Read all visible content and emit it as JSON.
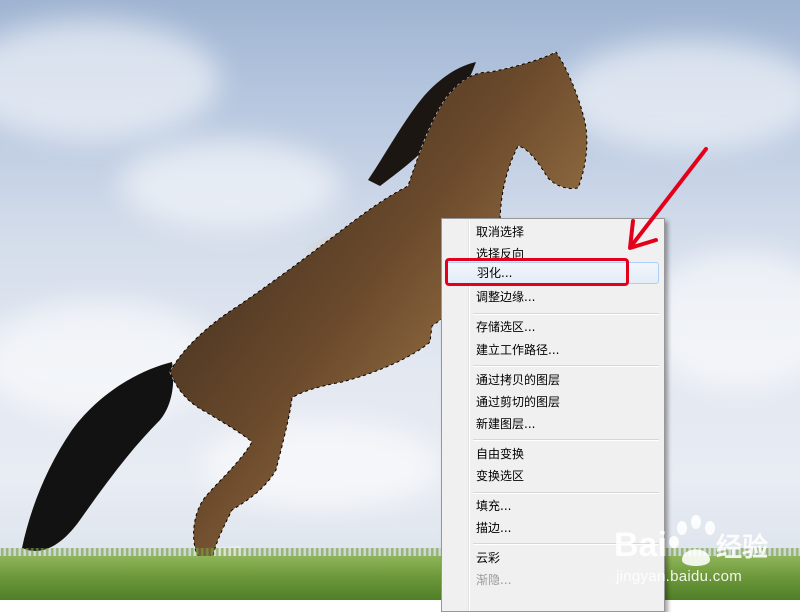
{
  "context_menu": {
    "items": [
      {
        "label": "取消选择"
      },
      {
        "label": "选择反向"
      },
      {
        "label": "羽化..."
      },
      {
        "label": "调整边缘..."
      },
      {
        "label": "存储选区..."
      },
      {
        "label": "建立工作路径..."
      },
      {
        "label": "通过拷贝的图层"
      },
      {
        "label": "通过剪切的图层"
      },
      {
        "label": "新建图层..."
      },
      {
        "label": "自由变换"
      },
      {
        "label": "变换选区"
      },
      {
        "label": "填充..."
      },
      {
        "label": "描边..."
      },
      {
        "label": "云彩"
      },
      {
        "label": "渐隐..."
      }
    ],
    "highlighted_item": "羽化...",
    "disabled_item": "渐隐..."
  },
  "annotation": {
    "color": "#e4001b",
    "shapes": [
      "rounded-rectangle",
      "arrow"
    ]
  },
  "watermark": {
    "brand": "Baidu经验",
    "url": "jingyan.baidu.com"
  },
  "canvas": {
    "subject": "horse-photo",
    "selection": "marching-ants"
  }
}
